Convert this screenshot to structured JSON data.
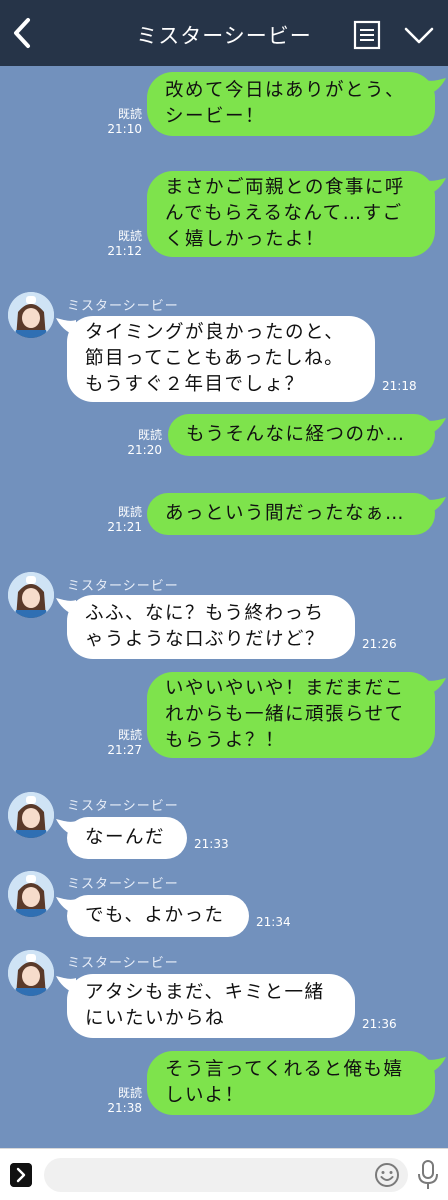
{
  "header": {
    "title": "ミスターシービー",
    "back_icon": "chevron-left-icon",
    "menu_icon": "list-icon",
    "collapse_icon": "chevron-down-icon"
  },
  "colors": {
    "header_bg": "#263448",
    "chat_bg": "#7291bd",
    "outgoing_bubble": "#7ee34c",
    "incoming_bubble": "#ffffff"
  },
  "sender_name": "ミスターシービー",
  "messages": [
    {
      "dir": "out",
      "text": "改めて今日はありがとう、\nシービー！",
      "read": "既読",
      "time": "21:10"
    },
    {
      "dir": "out",
      "text": "まさかご両親との食事に呼\nんでもらえるなんて…すご\nく嬉しかったよ！",
      "read": "既読",
      "time": "21:12"
    },
    {
      "dir": "in",
      "text": "タイミングが良かったのと、\n節目ってこともあったしね。\nもうすぐ２年目でしょ？",
      "time": "21:18"
    },
    {
      "dir": "out",
      "text": "もうそんなに経つのか…",
      "read": "既読",
      "time": "21:20"
    },
    {
      "dir": "out",
      "text": "あっという間だったなぁ…",
      "read": "既読",
      "time": "21:21"
    },
    {
      "dir": "in",
      "text": "ふふ、なに？もう終わっち\nゃうような口ぶりだけど？",
      "time": "21:26"
    },
    {
      "dir": "out",
      "text": "いやいやいや！まだまだこ\nれからも一緒に頑張らせて\nもらうよ？！",
      "read": "既読",
      "time": "21:27"
    },
    {
      "dir": "in",
      "text": "なーんだ",
      "time": "21:33"
    },
    {
      "dir": "in",
      "text": "でも、よかった",
      "time": "21:34"
    },
    {
      "dir": "in",
      "text": "アタシもまだ、キミと一緒\nにいたいからね",
      "time": "21:36"
    },
    {
      "dir": "out",
      "text": "そう言ってくれると俺も嬉\nしいよ！",
      "read": "既読",
      "time": "21:38"
    }
  ],
  "footer": {
    "input_value": "",
    "expand_icon": "chevron-right-icon",
    "emoji_icon": "smiley-icon",
    "mic_icon": "microphone-icon"
  }
}
